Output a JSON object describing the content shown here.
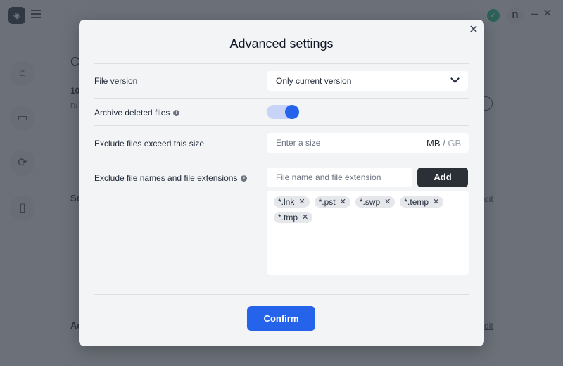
{
  "app": {
    "logo_text": "◈",
    "avatar_initial": "n",
    "status_icon": "✓",
    "window_controls": {
      "minimize": "–",
      "close": "✕"
    },
    "sidenav_icons": [
      "home-icon",
      "monitor-icon",
      "sync-icon",
      "phone-icon"
    ],
    "background_fragments": {
      "c": "C",
      "ten": "10",
      "ds": "Di",
      "s": "Se",
      "a": "Ac",
      "edit1": "dit",
      "edit2": "dit"
    }
  },
  "modal": {
    "title": "Advanced settings",
    "close_glyph": "✕",
    "file_version": {
      "label": "File version",
      "selected": "Only current version"
    },
    "archive_deleted": {
      "label": "Archive deleted files",
      "enabled": true
    },
    "exclude_size": {
      "label": "Exclude files exceed this size",
      "placeholder": "Enter a size",
      "unit_mb": "MB",
      "unit_sep": "/",
      "unit_gb": "GB"
    },
    "exclude_names": {
      "label": "Exclude file names and file extensions",
      "placeholder": "File name and file extension",
      "add_label": "Add",
      "tags": [
        "*.lnk",
        "*.pst",
        "*.swp",
        "*.temp",
        "*.tmp"
      ]
    },
    "confirm_label": "Confirm"
  },
  "colors": {
    "accent": "#2563eb",
    "dark_button": "#2b3037",
    "overlay": "#373e48"
  }
}
